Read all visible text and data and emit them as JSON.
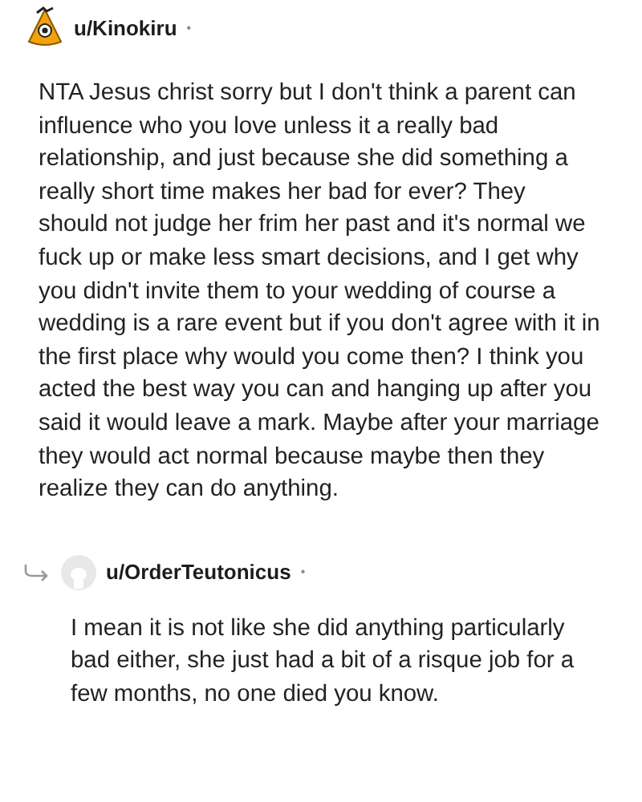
{
  "comments": [
    {
      "kind": "comment",
      "username": "u/Kinokiru",
      "separator": "•",
      "body": "NTA Jesus christ sorry but I don't think a parent can influence who you love unless it a really bad relationship, and just because she did something a really short time makes her bad for ever? They should not judge her frim her past and it's normal we fuck up or make less smart decisions, and I get why you didn't invite them to your wedding of course a wedding is a rare event but if you don't agree with it in the first place why would you come then? I think you acted the best way you can and hanging up after you said it would leave a mark. Maybe after your marriage they would act normal because maybe then they realize they can do anything."
    },
    {
      "kind": "reply",
      "username": "u/OrderTeutonicus",
      "separator": "•",
      "body": "I mean it is not like she did anything particularly bad either, she just had a bit of a risque job for a few months, no one died you know."
    }
  ]
}
